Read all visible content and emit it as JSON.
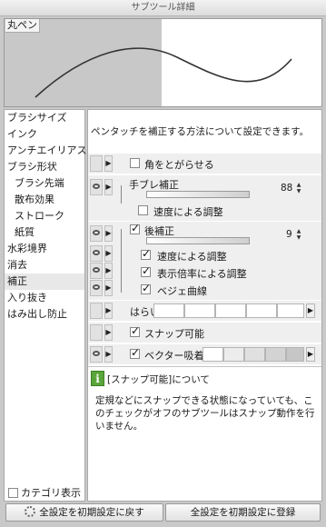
{
  "window": {
    "title": "サブツール詳細"
  },
  "preview": {
    "label": "丸ペン"
  },
  "sidebar": {
    "items": [
      {
        "label": "ブラシサイズ"
      },
      {
        "label": "インク"
      },
      {
        "label": "アンチエイリアス"
      },
      {
        "label": "ブラシ形状"
      },
      {
        "label": "ブラシ先端"
      },
      {
        "label": "散布効果"
      },
      {
        "label": "ストローク"
      },
      {
        "label": "紙質"
      },
      {
        "label": "水彩境界"
      },
      {
        "label": "消去"
      },
      {
        "label": "補正"
      },
      {
        "label": "入り抜き"
      },
      {
        "label": "はみ出し防止"
      }
    ],
    "selected": "補正",
    "category_toggle_label": "カテゴリ表示"
  },
  "panel": {
    "description": "ペンタッチを補正する方法について設定できます。",
    "corner": {
      "label": "角をとがらせる",
      "checked": false
    },
    "stabilization": {
      "label": "手ブレ補正",
      "value": "88",
      "level": 0.88
    },
    "stab_speed": {
      "label": "速度による調整",
      "checked": false
    },
    "post_correction": {
      "label": "後補正",
      "value": "9",
      "checked": true
    },
    "post_speed": {
      "label": "速度による調整",
      "checked": true
    },
    "display_zoom": {
      "label": "表示倍率による調整",
      "checked": true
    },
    "bezier": {
      "label": "ベジェ曲線",
      "checked": true
    },
    "harai": {
      "label": "はらい"
    },
    "snap": {
      "label": "スナップ可能",
      "checked": true
    },
    "vector_snap": {
      "label": "ベクター吸着",
      "checked": true
    }
  },
  "info": {
    "title": "[スナップ可能]について",
    "body": "定規などにスナップできる状態になっていても、このチェックがオフのサブツールはスナップ動作を行いません。"
  },
  "buttons": {
    "reset": "全設定を初期設定に戻す",
    "register": "全設定を初期設定に登録"
  }
}
